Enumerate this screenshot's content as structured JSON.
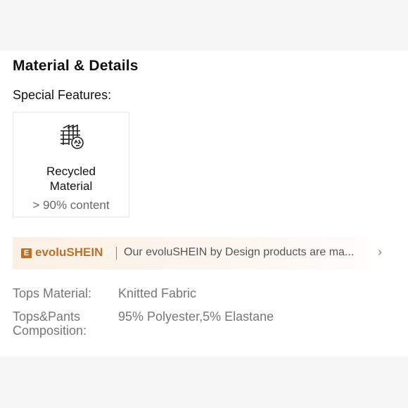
{
  "section": {
    "title": "Material & Details",
    "features_label": "Special Features:"
  },
  "feature": {
    "icon": "recycled-fabric-icon",
    "name_line1": "Recycled",
    "name_line2": "Material",
    "value": "> 90% content"
  },
  "banner": {
    "badge": "E",
    "brand": "evoluSHEIN",
    "text": "Our evoluSHEIN by Design products are ma...",
    "chevron": "›",
    "brand_color": "#b8722c"
  },
  "specs": [
    {
      "label": "Tops Material:",
      "value": "Knitted Fabric"
    },
    {
      "label_line1": "Tops&Pants",
      "label_line2": "Composition:",
      "value": "95% Polyester,5% Elastane"
    }
  ]
}
